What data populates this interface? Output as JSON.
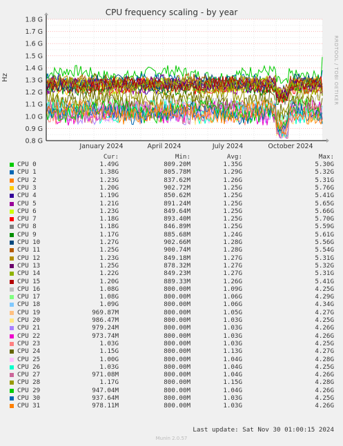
{
  "chart_data": {
    "type": "line",
    "title": "CPU frequency scaling - by year",
    "ylabel": "Hz",
    "side_label": "RRDTOOL / TOBI OETIKER",
    "y_ticks": [
      "1.8 G",
      "1.7 G",
      "1.6 G",
      "1.5 G",
      "1.4 G",
      "1.3 G",
      "1.2 G",
      "1.1 G",
      "1.0 G",
      "0.9 G",
      "0.8 G"
    ],
    "ylim": [
      0.8,
      1.8
    ],
    "x_ticks": [
      "January 2024",
      "April 2024",
      "July 2024",
      "October 2024"
    ],
    "grid": true,
    "columns": {
      "cur": "Cur:",
      "min": "Min:",
      "avg": "Avg:",
      "max": "Max:"
    },
    "series": [
      {
        "name": "CPU 0",
        "color": "#00cc00",
        "cur": "1.49G",
        "min": "809.20M",
        "avg": "1.35G",
        "max": "5.30G"
      },
      {
        "name": "CPU 1",
        "color": "#0066b3",
        "cur": "1.38G",
        "min": "805.78M",
        "avg": "1.29G",
        "max": "5.32G"
      },
      {
        "name": "CPU 2",
        "color": "#ff8000",
        "cur": "1.23G",
        "min": "837.62M",
        "avg": "1.26G",
        "max": "5.31G"
      },
      {
        "name": "CPU 3",
        "color": "#ffcc00",
        "cur": "1.20G",
        "min": "902.72M",
        "avg": "1.25G",
        "max": "5.76G"
      },
      {
        "name": "CPU 4",
        "color": "#330099",
        "cur": "1.19G",
        "min": "850.62M",
        "avg": "1.25G",
        "max": "5.41G"
      },
      {
        "name": "CPU 5",
        "color": "#990099",
        "cur": "1.21G",
        "min": "891.24M",
        "avg": "1.25G",
        "max": "5.65G"
      },
      {
        "name": "CPU 6",
        "color": "#ccff00",
        "cur": "1.23G",
        "min": "849.64M",
        "avg": "1.25G",
        "max": "5.66G"
      },
      {
        "name": "CPU 7",
        "color": "#ff0000",
        "cur": "1.18G",
        "min": "893.40M",
        "avg": "1.25G",
        "max": "5.70G"
      },
      {
        "name": "CPU 8",
        "color": "#808080",
        "cur": "1.18G",
        "min": "846.89M",
        "avg": "1.25G",
        "max": "5.59G"
      },
      {
        "name": "CPU 9",
        "color": "#008f00",
        "cur": "1.17G",
        "min": "885.68M",
        "avg": "1.24G",
        "max": "5.61G"
      },
      {
        "name": "CPU 10",
        "color": "#00487d",
        "cur": "1.27G",
        "min": "902.66M",
        "avg": "1.28G",
        "max": "5.56G"
      },
      {
        "name": "CPU 11",
        "color": "#b35a00",
        "cur": "1.25G",
        "min": "900.74M",
        "avg": "1.28G",
        "max": "5.54G"
      },
      {
        "name": "CPU 12",
        "color": "#b38f00",
        "cur": "1.23G",
        "min": "849.18M",
        "avg": "1.27G",
        "max": "5.31G"
      },
      {
        "name": "CPU 13",
        "color": "#6b006b",
        "cur": "1.25G",
        "min": "878.32M",
        "avg": "1.27G",
        "max": "5.32G"
      },
      {
        "name": "CPU 14",
        "color": "#8fb300",
        "cur": "1.22G",
        "min": "849.23M",
        "avg": "1.27G",
        "max": "5.31G"
      },
      {
        "name": "CPU 15",
        "color": "#b30000",
        "cur": "1.20G",
        "min": "889.33M",
        "avg": "1.26G",
        "max": "5.41G"
      },
      {
        "name": "CPU 16",
        "color": "#bebebe",
        "cur": "1.08G",
        "min": "800.00M",
        "avg": "1.09G",
        "max": "4.25G"
      },
      {
        "name": "CPU 17",
        "color": "#80ff80",
        "cur": "1.08G",
        "min": "800.00M",
        "avg": "1.06G",
        "max": "4.29G"
      },
      {
        "name": "CPU 18",
        "color": "#80c9ff",
        "cur": "1.09G",
        "min": "800.00M",
        "avg": "1.06G",
        "max": "4.34G"
      },
      {
        "name": "CPU 19",
        "color": "#ffc080",
        "cur": "969.87M",
        "min": "800.00M",
        "avg": "1.05G",
        "max": "4.27G"
      },
      {
        "name": "CPU 20",
        "color": "#ffe680",
        "cur": "986.47M",
        "min": "800.00M",
        "avg": "1.03G",
        "max": "4.25G"
      },
      {
        "name": "CPU 21",
        "color": "#aa80ff",
        "cur": "979.24M",
        "min": "800.00M",
        "avg": "1.03G",
        "max": "4.26G"
      },
      {
        "name": "CPU 22",
        "color": "#ee00cc",
        "cur": "973.74M",
        "min": "800.00M",
        "avg": "1.03G",
        "max": "4.26G"
      },
      {
        "name": "CPU 23",
        "color": "#ff8080",
        "cur": "1.03G",
        "min": "800.00M",
        "avg": "1.03G",
        "max": "4.25G"
      },
      {
        "name": "CPU 24",
        "color": "#666600",
        "cur": "1.15G",
        "min": "800.00M",
        "avg": "1.13G",
        "max": "4.27G"
      },
      {
        "name": "CPU 25",
        "color": "#ffbfff",
        "cur": "1.00G",
        "min": "800.00M",
        "avg": "1.04G",
        "max": "4.28G"
      },
      {
        "name": "CPU 26",
        "color": "#00ffcc",
        "cur": "1.03G",
        "min": "800.00M",
        "avg": "1.04G",
        "max": "4.25G"
      },
      {
        "name": "CPU 27",
        "color": "#cc6699",
        "cur": "971.08M",
        "min": "800.00M",
        "avg": "1.04G",
        "max": "4.26G"
      },
      {
        "name": "CPU 28",
        "color": "#999900",
        "cur": "1.17G",
        "min": "800.00M",
        "avg": "1.15G",
        "max": "4.28G"
      },
      {
        "name": "CPU 29",
        "color": "#00cc00",
        "cur": "947.04M",
        "min": "800.00M",
        "avg": "1.04G",
        "max": "4.26G"
      },
      {
        "name": "CPU 30",
        "color": "#0066b3",
        "cur": "937.64M",
        "min": "800.00M",
        "avg": "1.03G",
        "max": "4.25G"
      },
      {
        "name": "CPU 31",
        "color": "#ff8000",
        "cur": "978.11M",
        "min": "800.00M",
        "avg": "1.03G",
        "max": "4.26G"
      }
    ]
  },
  "last_update": "Last update: Sat Nov 30 01:00:15 2024",
  "footer": "Munin 2.0.57"
}
